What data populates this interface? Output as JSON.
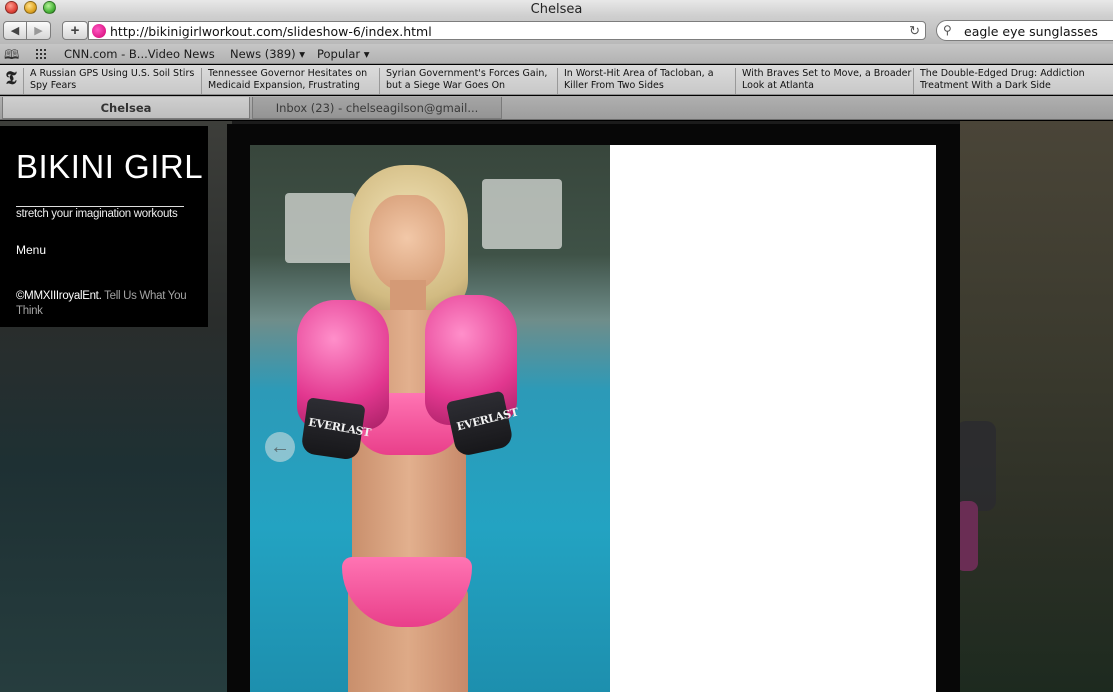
{
  "window": {
    "title": "Chelsea"
  },
  "toolbar": {
    "back_label": "◀",
    "forward_label": "▶",
    "add_label": "+",
    "url": "http://bikinigirlworkout.com/slideshow-6/index.html",
    "reload_icon": "↻",
    "search_value": "eagle eye sunglasses"
  },
  "bookmarks": {
    "items": [
      {
        "label": "CNN.com - B...Video News"
      },
      {
        "label": "News (389) ▾"
      },
      {
        "label": "Popular ▾"
      }
    ]
  },
  "news": {
    "items": [
      {
        "line1": "A Russian GPS Using U.S. Soil Stirs",
        "line2": "Spy Fears"
      },
      {
        "line1": "Tennessee Governor Hesitates on",
        "line2": "Medicaid Expansion, Frustrating"
      },
      {
        "line1": "Syrian Government's Forces Gain,",
        "line2": "but a Siege War Goes On"
      },
      {
        "line1": "In Worst-Hit Area of Tacloban, a",
        "line2": "Killer From Two Sides"
      },
      {
        "line1": "With Braves Set to Move, a Broader",
        "line2": "Look at Atlanta"
      },
      {
        "line1": "The Double-Edged Drug: Addiction",
        "line2": "Treatment With a Dark Side"
      }
    ]
  },
  "tabs": [
    {
      "label": "Chelsea"
    },
    {
      "label": "Inbox (23) - chelseagilson@gmail..."
    }
  ],
  "site": {
    "logo": "BIKINI GIRL",
    "tagline": "stretch your imagination workouts",
    "menu": "Menu",
    "copyright": "©MMXIIIroyalEnt.",
    "feedback_link": "Tell Us What You Think"
  },
  "slideshow": {
    "glove_brand": "EVERLAST",
    "prev_icon": "←"
  },
  "colors": {
    "accent_pink": "#e93f8a",
    "pool_blue": "#23a3c2"
  }
}
